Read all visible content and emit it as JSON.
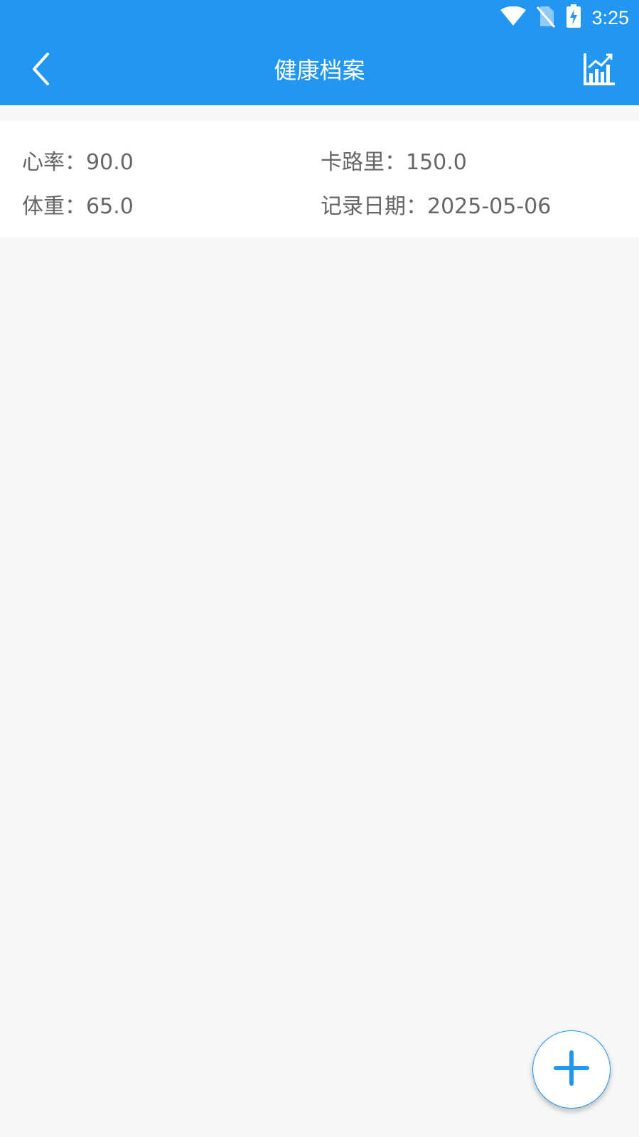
{
  "status_bar": {
    "time": "3:25",
    "icons": [
      "wifi-icon",
      "no-sim-icon",
      "battery-charging-icon"
    ]
  },
  "app_bar": {
    "title": "健康档案",
    "back_icon": "chevron-left-icon",
    "action_icon": "chart-icon"
  },
  "record": {
    "heart_rate_label": "心率：",
    "heart_rate_value": "90.0",
    "calories_label": "卡路里：",
    "calories_value": "150.0",
    "weight_label": "体重：",
    "weight_value": "65.0",
    "date_label": "记录日期：",
    "date_value": "2025-05-06"
  },
  "fab": {
    "icon": "plus-icon"
  },
  "colors": {
    "primary": "#2196f3",
    "background": "#f8f8f8",
    "card": "#ffffff",
    "text_secondary": "#666666"
  }
}
